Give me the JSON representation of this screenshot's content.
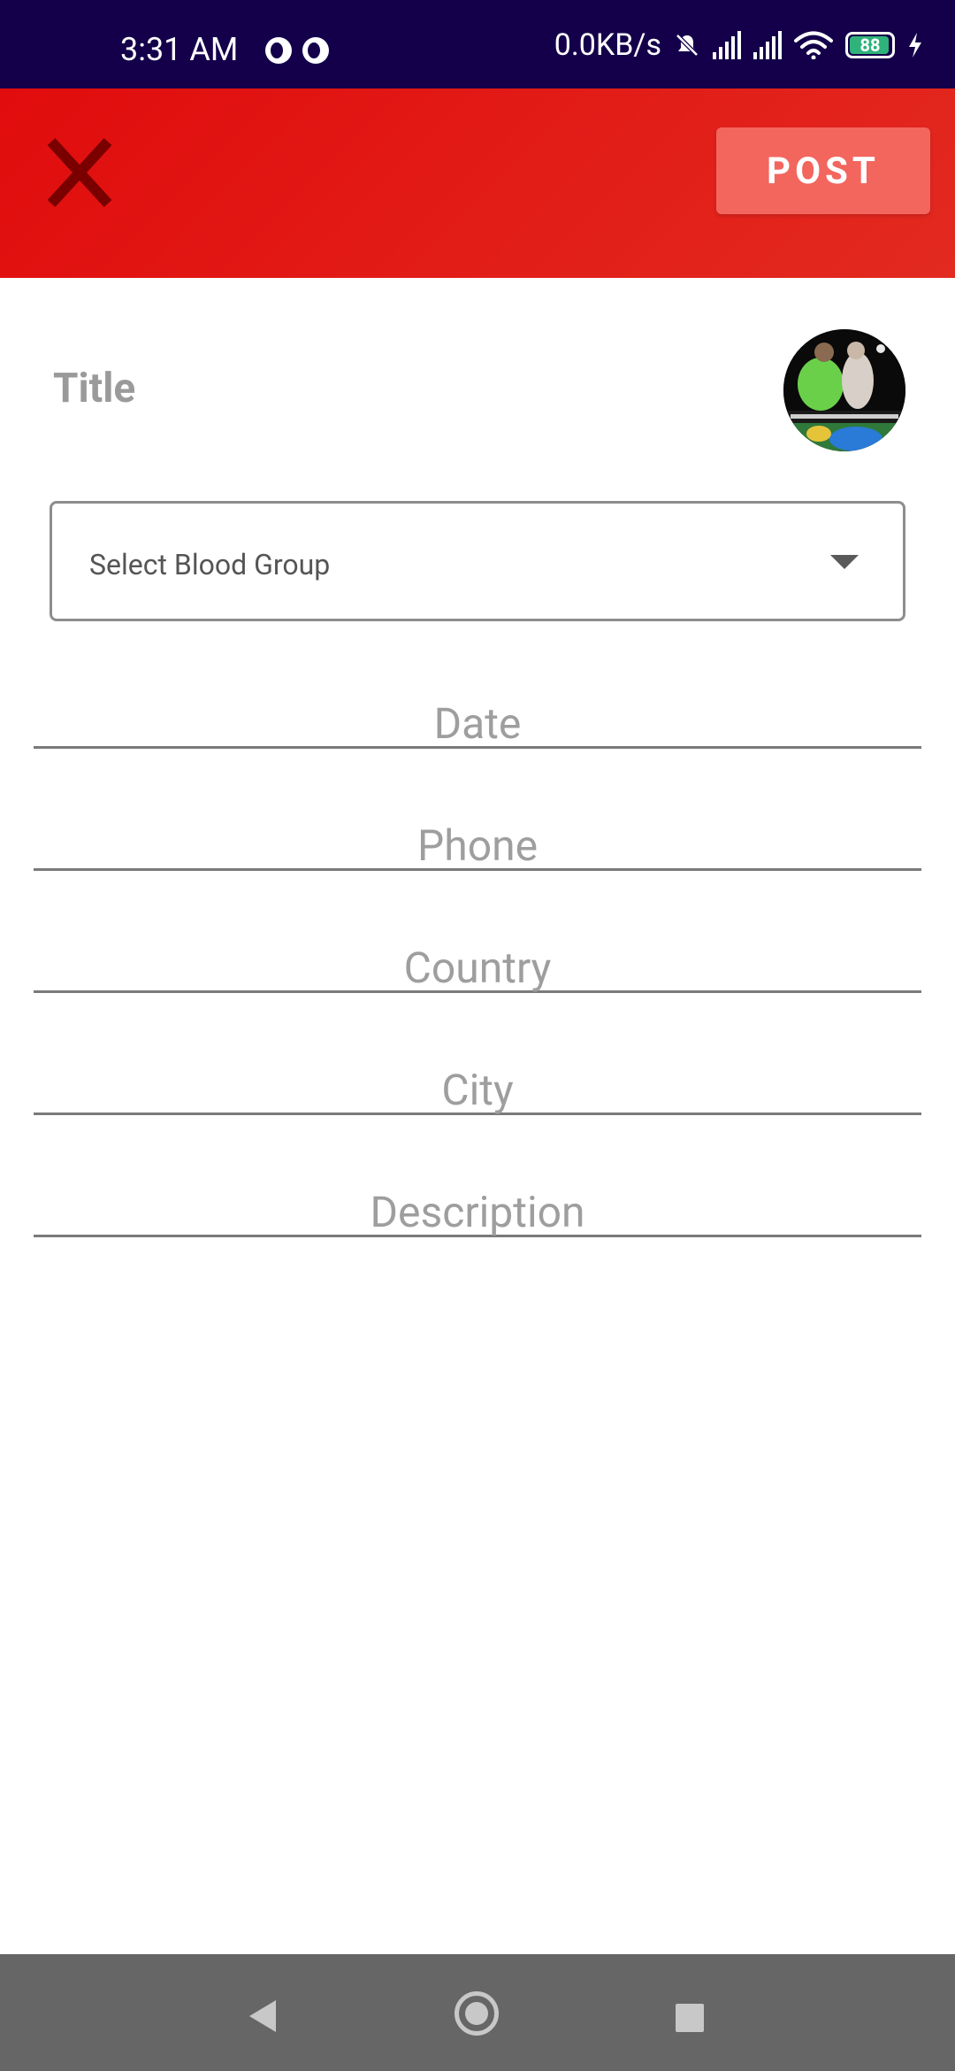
{
  "status_bar": {
    "time": "3:31 AM",
    "net_speed": "0.0KB/s",
    "battery_level": "88",
    "icons": [
      "app-notification-icon",
      "app-notification-icon",
      "mute-icon",
      "signal-icon",
      "signal-icon",
      "wifi-icon",
      "battery-icon",
      "charging-icon"
    ],
    "background_color": "#14004a"
  },
  "app_bar": {
    "close_icon": "close-icon",
    "post_label": "POST",
    "gradient_start": "#e10c0d",
    "gradient_end": "#e22a20",
    "post_button_color": "#f2665e"
  },
  "form": {
    "title_label": "Title",
    "avatar": "profile-photo",
    "blood_group_select": {
      "selected_value": "Select Blood Group"
    },
    "fields": {
      "date_placeholder": "Date",
      "phone_placeholder": "Phone",
      "country_placeholder": "Country",
      "city_placeholder": "City",
      "description_placeholder": "Description"
    }
  },
  "nav_bar": {
    "back": "back-icon",
    "home": "home-icon",
    "recents": "recents-icon"
  }
}
